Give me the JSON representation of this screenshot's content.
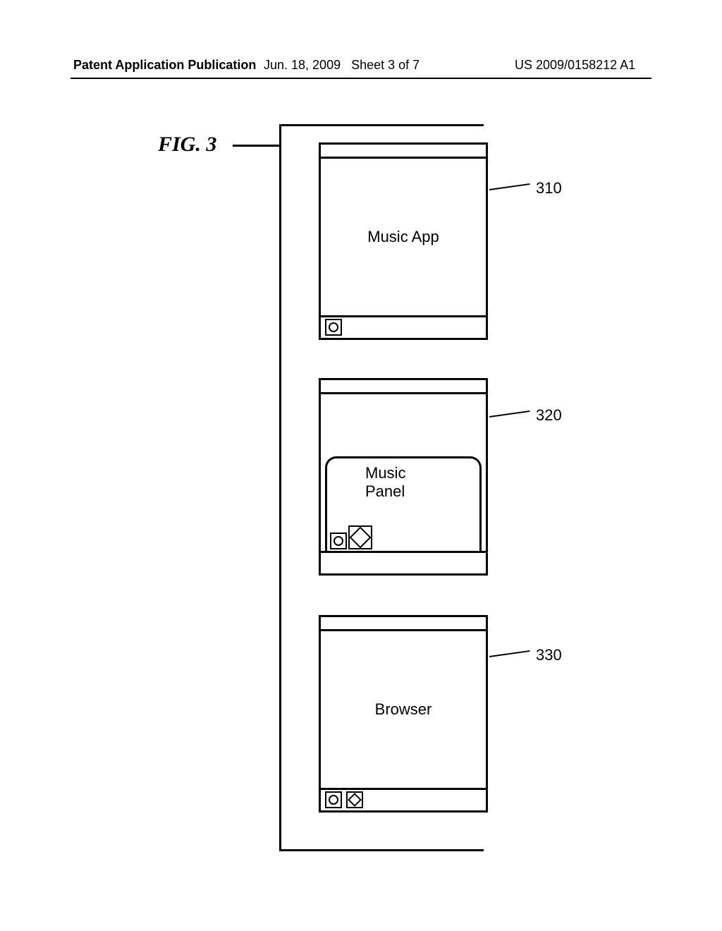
{
  "header": {
    "left": "Patent Application Publication",
    "date": "Jun. 18, 2009",
    "sheet": "Sheet 3 of 7",
    "pubno": "US 2009/0158212 A1"
  },
  "figure_label": "FIG. 3",
  "devices": {
    "d1": {
      "label": "Music App",
      "ref": "310"
    },
    "d2": {
      "label": "Music Panel",
      "ref": "320"
    },
    "d3": {
      "label": "Browser",
      "ref": "330"
    }
  }
}
